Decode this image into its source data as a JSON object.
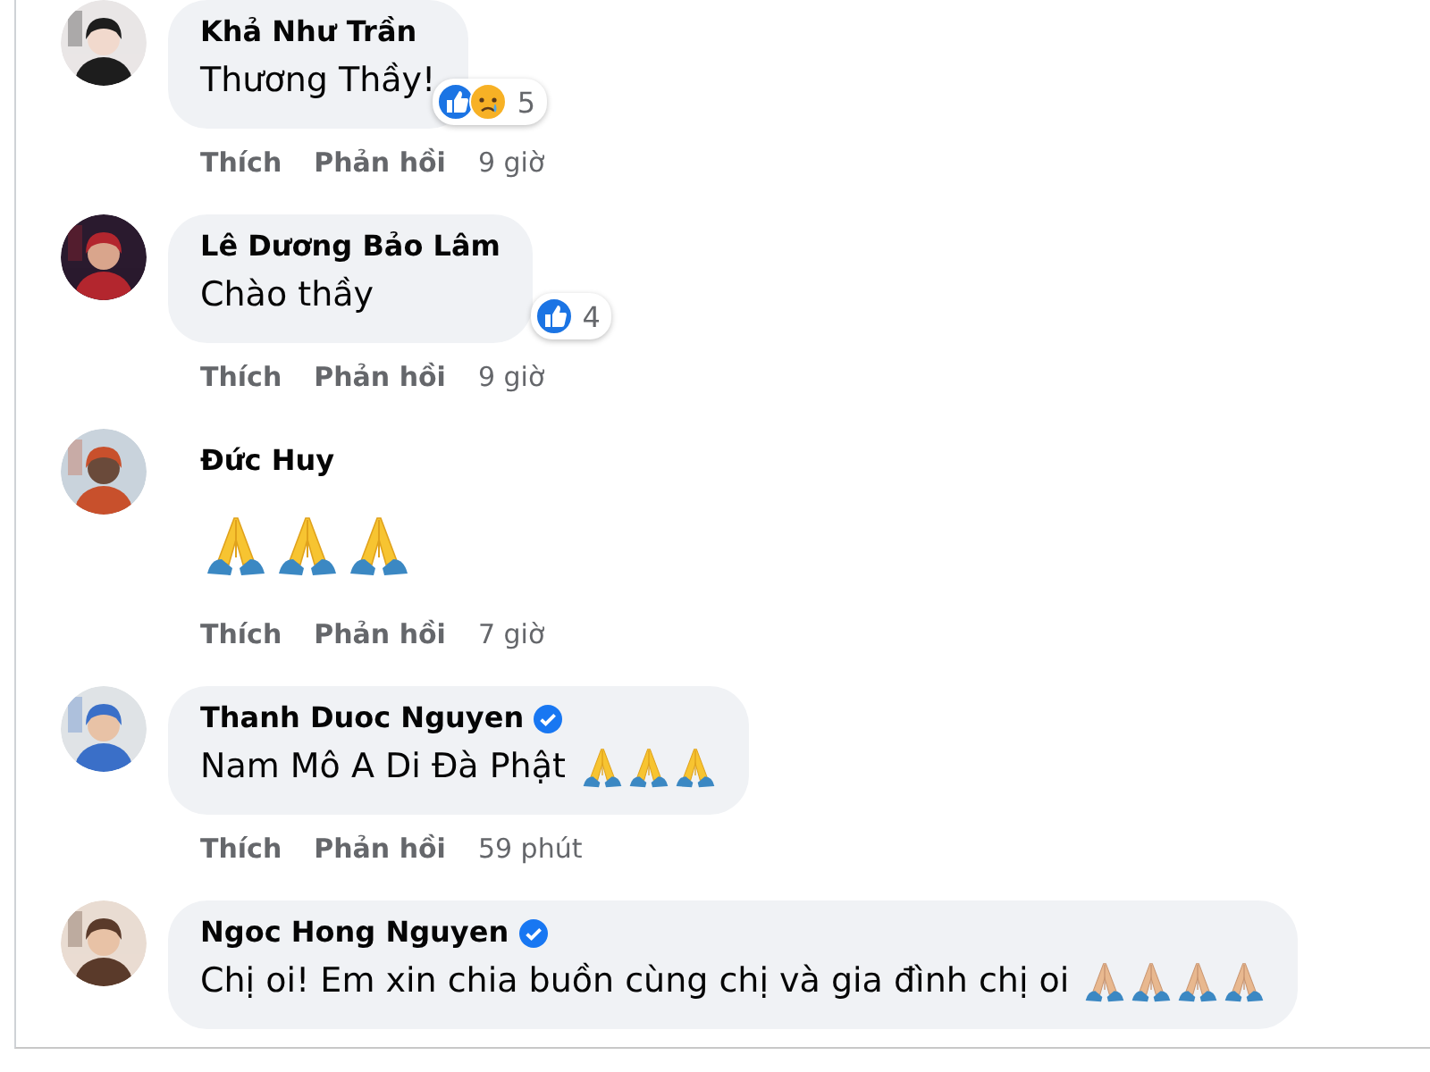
{
  "comments": [
    {
      "author": "Khả Như Trần",
      "verified": false,
      "bubble": true,
      "text": "Thương Thầy!",
      "reactions": {
        "icons": [
          {
            "kind": "like"
          },
          {
            "kind": "sad"
          }
        ],
        "count": "5"
      },
      "actions": {
        "like": "Thích",
        "reply": "Phản hồi",
        "time": "9 giờ"
      }
    },
    {
      "author": "Lê Dương Bảo Lâm",
      "verified": false,
      "bubble": true,
      "text": "Chào thầy",
      "reactions": {
        "icons": [
          {
            "kind": "like"
          }
        ],
        "count": "4"
      },
      "actions": {
        "like": "Thích",
        "reply": "Phản hồi",
        "time": "9 giờ"
      }
    },
    {
      "author": "Đức Huy",
      "verified": false,
      "bubble": false,
      "emojis": [
        {
          "kind": "pray-yellow"
        },
        {
          "kind": "pray-yellow"
        },
        {
          "kind": "pray-yellow"
        }
      ],
      "actions": {
        "like": "Thích",
        "reply": "Phản hồi",
        "time": "7 giờ"
      }
    },
    {
      "author": "Thanh Duoc Nguyen",
      "verified": true,
      "bubble": true,
      "text": "Nam Mô A Di Đà Phật",
      "emojis": [
        {
          "kind": "pray-yellow"
        },
        {
          "kind": "pray-yellow"
        },
        {
          "kind": "pray-yellow"
        }
      ],
      "actions": {
        "like": "Thích",
        "reply": "Phản hồi",
        "time": "59 phút"
      }
    },
    {
      "author": "Ngoc Hong Nguyen",
      "verified": true,
      "bubble": true,
      "text": "Chị oi! Em xin chia buồn cùng chị và gia đình chị oi",
      "emojis": [
        {
          "kind": "pray-light"
        },
        {
          "kind": "pray-light"
        },
        {
          "kind": "pray-light"
        },
        {
          "kind": "pray-light"
        }
      ]
    }
  ]
}
